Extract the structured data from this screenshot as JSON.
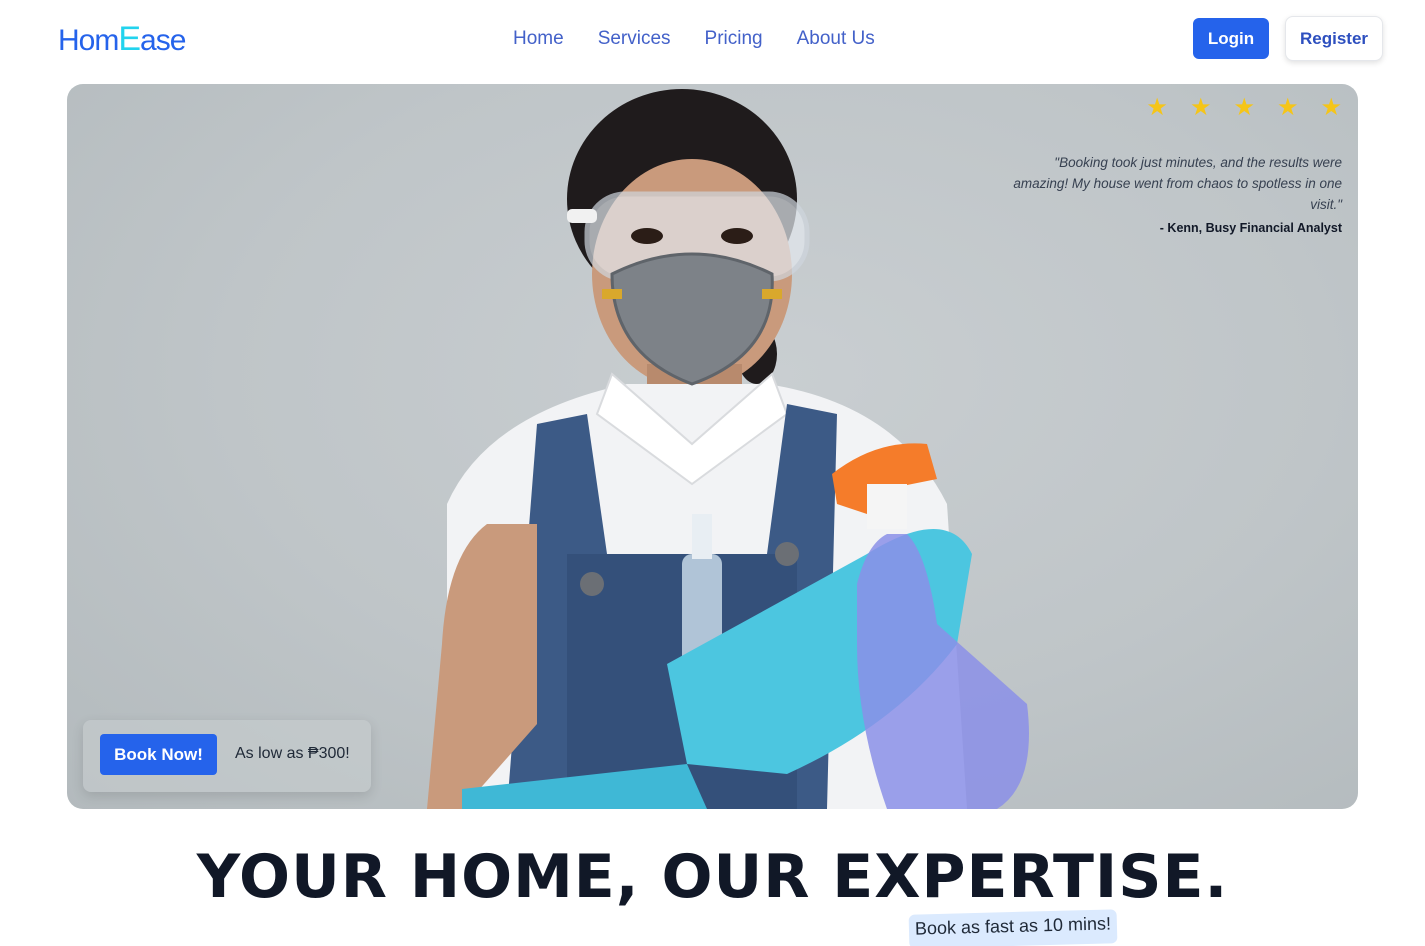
{
  "brand": {
    "logo_part1": "Hom",
    "logo_part2": "E",
    "logo_part3": "ase",
    "primary_color": "#2563eb",
    "accent_color": "#22d3ee"
  },
  "nav": {
    "items": [
      {
        "label": "Home"
      },
      {
        "label": "Services"
      },
      {
        "label": "Pricing"
      },
      {
        "label": "About Us"
      }
    ]
  },
  "auth": {
    "login_label": "Login",
    "register_label": "Register"
  },
  "hero": {
    "rating_stars": 5,
    "star_icon": "star-icon",
    "testimonial_quote": "\"Booking took just minutes, and the results were amazing! My house went from chaos to spotless in one visit.\"",
    "testimonial_author": "- Kenn, Busy Financial Analyst",
    "book_label": "Book Now!",
    "price_note": "As low as ₱300!"
  },
  "headline": {
    "title": "YOUR HOME, OUR EXPERTISE.",
    "badge": "Book as fast as 10 mins!"
  }
}
